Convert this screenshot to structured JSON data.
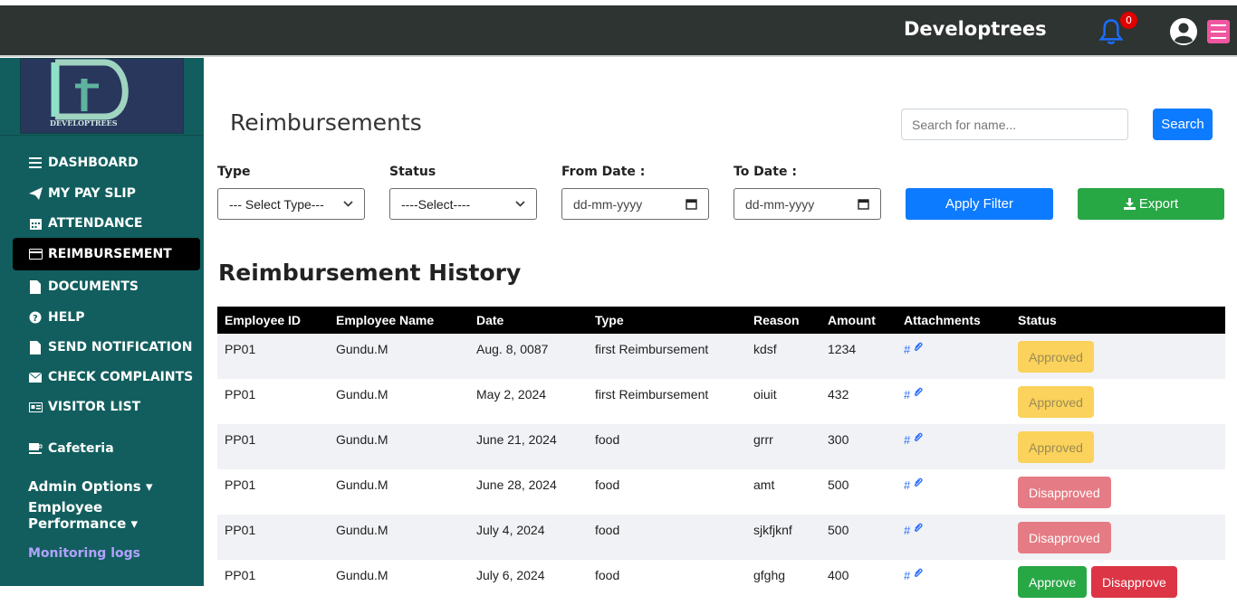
{
  "topbar": {
    "brand": "Developtrees",
    "notification_count": "0"
  },
  "sidebar": {
    "logo_text": "DEVELOPTREES",
    "nav": [
      {
        "label": "DASHBOARD",
        "icon": "bars-icon"
      },
      {
        "label": "MY PAY SLIP",
        "icon": "paper-plane-icon"
      },
      {
        "label": "ATTENDANCE",
        "icon": "calendar-icon"
      },
      {
        "label": "REIMBURSEMENT",
        "icon": "credit-card-icon",
        "active": true
      },
      {
        "label": "DOCUMENTS",
        "icon": "file-icon"
      },
      {
        "label": "HELP",
        "icon": "question-circle-icon"
      },
      {
        "label": "SEND NOTIFICATION",
        "icon": "file-icon"
      },
      {
        "label": "CHECK COMPLAINTS",
        "icon": "envelope-icon"
      },
      {
        "label": "VISITOR LIST",
        "icon": "id-card-icon"
      }
    ],
    "cafeteria": "Cafeteria",
    "admin_options": "Admin Options",
    "employee_performance": "Employee Performance",
    "monitoring_logs": "Monitoring logs"
  },
  "header": {
    "title": "Reimbursements",
    "search_placeholder": "Search for name...",
    "search_button": "Search"
  },
  "filters": {
    "type_label": "Type",
    "type_value": "--- Select Type---",
    "status_label": "Status",
    "status_value": "----Select----",
    "from_label": "From Date :",
    "from_placeholder": "dd-mm-yyyy",
    "to_label": "To Date :",
    "to_placeholder": "dd-mm-yyyy",
    "apply_button": "Apply Filter",
    "export_button": "Export"
  },
  "history": {
    "title": "Reimbursement History",
    "columns": [
      "Employee ID",
      "Employee Name",
      "Date",
      "Type",
      "Reason",
      "Amount",
      "Attachments",
      "Status"
    ],
    "rows": [
      {
        "id": "PP01",
        "name": "Gundu.M",
        "date": "Aug. 8, 0087",
        "type": "first Reimbursement",
        "reason": "kdsf",
        "amount": "1234",
        "attach": "#",
        "status": "Approved",
        "status_kind": "approved"
      },
      {
        "id": "PP01",
        "name": "Gundu.M",
        "date": "May 2, 2024",
        "type": "first Reimbursement",
        "reason": "oiuit",
        "amount": "432",
        "attach": "#",
        "status": "Approved",
        "status_kind": "approved"
      },
      {
        "id": "PP01",
        "name": "Gundu.M",
        "date": "June 21, 2024",
        "type": "food",
        "reason": "grrr",
        "amount": "300",
        "attach": "#",
        "status": "Approved",
        "status_kind": "approved"
      },
      {
        "id": "PP01",
        "name": "Gundu.M",
        "date": "June 28, 2024",
        "type": "food",
        "reason": "amt",
        "amount": "500",
        "attach": "#",
        "status": "Disapproved",
        "status_kind": "disapproved"
      },
      {
        "id": "PP01",
        "name": "Gundu.M",
        "date": "July 4, 2024",
        "type": "food",
        "reason": "sjkfjknf",
        "amount": "500",
        "attach": "#",
        "status": "Disapproved",
        "status_kind": "disapproved"
      },
      {
        "id": "PP01",
        "name": "Gundu.M",
        "date": "July 6, 2024",
        "type": "food",
        "reason": "gfghg",
        "amount": "400",
        "attach": "#",
        "approve_label": "Approve",
        "disapprove_label": "Disapprove",
        "status_kind": "pending"
      }
    ]
  },
  "colors": {
    "topbar": "#2e3431",
    "sidebar": "#125e5e",
    "primary": "#0d7bff",
    "success": "#28a745",
    "danger": "#dc3545",
    "warning_badge": "#fbd25b"
  }
}
